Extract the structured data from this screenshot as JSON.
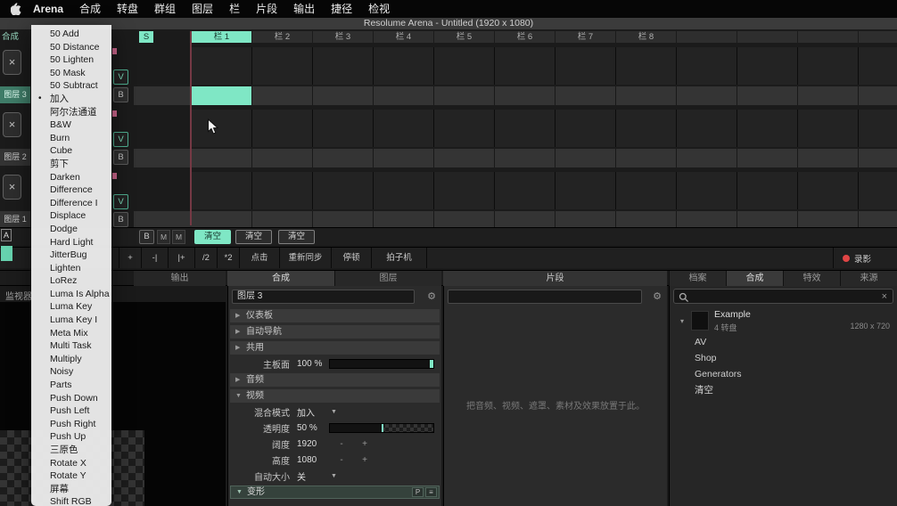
{
  "menubar": {
    "items": [
      "Arena",
      "合成",
      "转盘",
      "群组",
      "图层",
      "栏",
      "片段",
      "输出",
      "捷径",
      "检视"
    ]
  },
  "titlebar": {
    "title": "Resolume Arena - Untitled (1920 x 1080)"
  },
  "menu": {
    "items": [
      {
        "label": "50 Add",
        "marked": false
      },
      {
        "label": "50 Distance",
        "marked": false
      },
      {
        "label": "50 Lighten",
        "marked": false
      },
      {
        "label": "50 Mask",
        "marked": false
      },
      {
        "label": "50 Subtract",
        "marked": false
      },
      {
        "label": "加入",
        "marked": true
      },
      {
        "label": "阿尔法通道",
        "marked": false
      },
      {
        "label": "B&W",
        "marked": false
      },
      {
        "label": "Burn",
        "marked": false
      },
      {
        "label": "Cube",
        "marked": false
      },
      {
        "label": "剪下",
        "marked": false
      },
      {
        "label": "Darken",
        "marked": false
      },
      {
        "label": "Difference",
        "marked": false
      },
      {
        "label": "Difference I",
        "marked": false
      },
      {
        "label": "Displace",
        "marked": false
      },
      {
        "label": "Dodge",
        "marked": false
      },
      {
        "label": "Hard Light",
        "marked": false
      },
      {
        "label": "JitterBug",
        "marked": false
      },
      {
        "label": "Lighten",
        "marked": false
      },
      {
        "label": "LoRez",
        "marked": false
      },
      {
        "label": "Luma Is Alpha",
        "marked": false
      },
      {
        "label": "Luma Key",
        "marked": false
      },
      {
        "label": "Luma Key I",
        "marked": false
      },
      {
        "label": "Meta Mix",
        "marked": false
      },
      {
        "label": "Multi Task",
        "marked": false
      },
      {
        "label": "Multiply",
        "marked": false
      },
      {
        "label": "Noisy",
        "marked": false
      },
      {
        "label": "Parts",
        "marked": false
      },
      {
        "label": "Push Down",
        "marked": false
      },
      {
        "label": "Push Left",
        "marked": false
      },
      {
        "label": "Push Right",
        "marked": false
      },
      {
        "label": "Push Up",
        "marked": false
      },
      {
        "label": "三原色",
        "marked": false
      },
      {
        "label": "Rotate X",
        "marked": false
      },
      {
        "label": "Rotate Y",
        "marked": false
      },
      {
        "label": "屏幕",
        "marked": false
      },
      {
        "label": "Shift RGB",
        "marked": false
      }
    ]
  },
  "grid": {
    "corner_label": "合成",
    "s_button": "S",
    "clear_glyph": "×",
    "column_headers": [
      "栏 1",
      "栏 2",
      "栏 3",
      "栏 4",
      "栏 5",
      "栏 6",
      "栏 7",
      "栏 8"
    ],
    "selected_column": 0,
    "extra_columns": 4,
    "layers": [
      {
        "name": "图层 3",
        "b": "B",
        "v": "V",
        "selected": true,
        "active_clip_col": 0
      },
      {
        "name": "图层 2",
        "b": "B",
        "v": "V",
        "selected": false,
        "active_clip_col": -1
      },
      {
        "name": "图层 1",
        "b": "B",
        "v": "V",
        "selected": false,
        "active_clip_col": -1
      }
    ]
  },
  "transport": {
    "a_button": "A",
    "b_button": "B",
    "m_buttons": [
      "M",
      "M"
    ],
    "clear_buttons": [
      "清空",
      "清空",
      "清空"
    ]
  },
  "bpm_bar": {
    "buttons": [
      "+",
      "-|",
      "|+",
      "/2",
      "*2",
      "点击",
      "重新同步",
      "停顿",
      "拍子机"
    ],
    "record": "录影"
  },
  "tabs": {
    "output": "输出",
    "composition": "合成",
    "layer": "图层",
    "clip": "片段",
    "browser": [
      "档案",
      "合成",
      "特效",
      "来源"
    ],
    "browser_selected": 1
  },
  "monitor": {
    "label": "监视器"
  },
  "layer_panel": {
    "name": "图层 3",
    "dashboard": "仪表板",
    "autopilot": "自动导航",
    "common": "共用",
    "master_label": "主板面",
    "master_value": "100 %",
    "audio": "音频",
    "video": "视频",
    "blend_label": "混合模式",
    "blend_value": "加入",
    "opacity_label": "透明度",
    "opacity_value": "50 %",
    "width_label": "阔度",
    "width_value": "1920",
    "height_label": "高度",
    "height_value": "1080",
    "minus": "-",
    "plus": "+",
    "autosize_label": "自动大小",
    "autosize_value": "关",
    "transform_label": "变形",
    "transform_p": "P",
    "transform_menu": "≡"
  },
  "clip_panel": {
    "hint": "把音频、视频、遮罩、素材及效果放置于此。"
  },
  "browser": {
    "search_clear": "×",
    "items": [
      {
        "name": "Example",
        "meta": "4 转盘",
        "resolution": "1280 x 720",
        "expandable": true
      },
      {
        "name": "AV"
      },
      {
        "name": "Shop"
      },
      {
        "name": "Generators"
      },
      {
        "name": "清空"
      }
    ]
  }
}
